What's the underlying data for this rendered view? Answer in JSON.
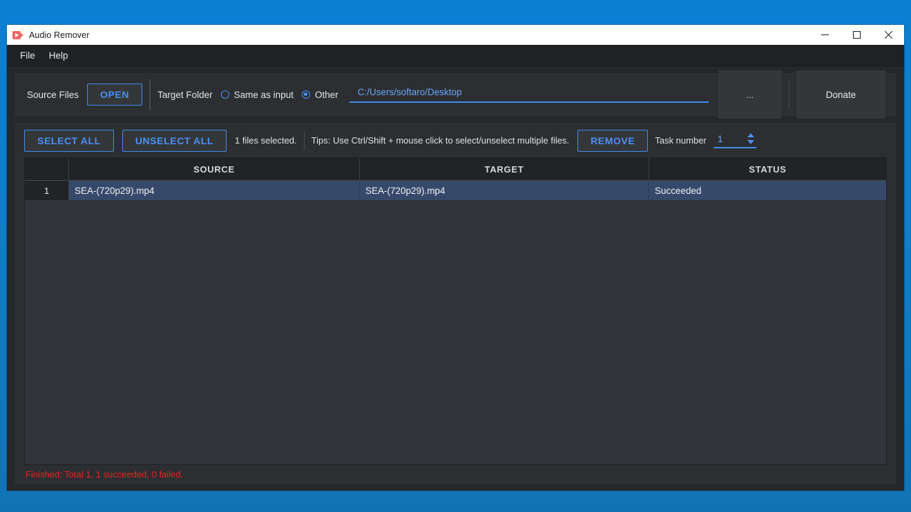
{
  "window": {
    "title": "Audio Remover",
    "icon": "video-camera-icon",
    "minimize_label": "minimize-icon",
    "maximize_label": "maximize-icon",
    "close_label": "close-icon"
  },
  "menu": {
    "items": [
      {
        "label": "File"
      },
      {
        "label": "Help"
      }
    ]
  },
  "toolbar_top": {
    "source_files_label": "Source Files",
    "open_button": "OPEN",
    "target_folder_label": "Target Folder",
    "radio_same_as_input": "Same as input",
    "radio_other": "Other",
    "radio_selected": "Other",
    "path_value": "C:/Users/softaro/Desktop",
    "path_placeholder": "C:/Users/softaro/Desktop",
    "browse_button": "...",
    "donate_button": "Donate"
  },
  "toolbar_bottom": {
    "select_all_button": "SELECT ALL",
    "unselect_all_button": "UNSELECT ALL",
    "files_selected_text": "1 files selected.",
    "tips_text": "Tips: Use Ctrl/Shift + mouse click to select/unselect multiple files.",
    "remove_button": "REMOVE",
    "task_number_label": "Task number",
    "task_number_value": "1"
  },
  "table": {
    "columns": [
      {
        "label": ""
      },
      {
        "label": "SOURCE"
      },
      {
        "label": "TARGET"
      },
      {
        "label": "STATUS"
      }
    ],
    "rows": [
      {
        "index": "1",
        "source": "SEA-(720p29).mp4",
        "target": "SEA-(720p29).mp4",
        "status": "Succeeded"
      }
    ]
  },
  "status_bar": {
    "message": "Finished: Total 1, 1 succeeded, 0 failed."
  },
  "colors": {
    "accent": "#4a90f7",
    "error": "#ee2222",
    "desktop": "#0a7fd4",
    "panel": "#2c2e31",
    "row_selected": "#37496b"
  }
}
